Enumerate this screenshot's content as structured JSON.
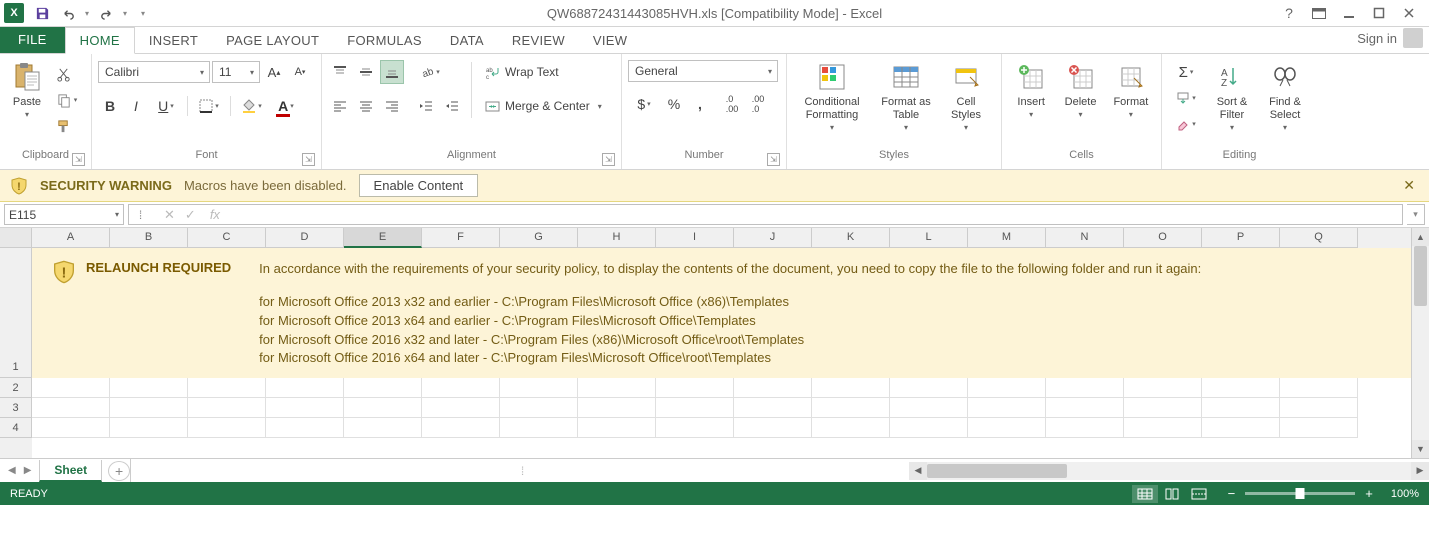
{
  "title": "QW68872431443085HVH.xls  [Compatibility Mode] - Excel",
  "signin": "Sign in",
  "tabs": {
    "file": "FILE",
    "home": "HOME",
    "insert": "INSERT",
    "page_layout": "PAGE LAYOUT",
    "formulas": "FORMULAS",
    "data": "DATA",
    "review": "REVIEW",
    "view": "VIEW"
  },
  "ribbon": {
    "clipboard": {
      "label": "Clipboard",
      "paste": "Paste"
    },
    "font": {
      "label": "Font",
      "name": "Calibri",
      "size": "11"
    },
    "alignment": {
      "label": "Alignment",
      "wrap": "Wrap Text",
      "merge": "Merge & Center"
    },
    "number": {
      "label": "Number",
      "format": "General"
    },
    "styles": {
      "label": "Styles",
      "cond": "Conditional Formatting",
      "table": "Format as Table",
      "cell": "Cell Styles"
    },
    "cells": {
      "label": "Cells",
      "insert": "Insert",
      "delete": "Delete",
      "format": "Format"
    },
    "editing": {
      "label": "Editing",
      "sort": "Sort & Filter",
      "find": "Find & Select"
    }
  },
  "security": {
    "title": "SECURITY WARNING",
    "msg": "Macros have been disabled.",
    "enable": "Enable Content"
  },
  "namebox": "E115",
  "fx_label": "fx",
  "columns": [
    "A",
    "B",
    "C",
    "D",
    "E",
    "F",
    "G",
    "H",
    "I",
    "J",
    "K",
    "L",
    "M",
    "N",
    "O",
    "P",
    "Q"
  ],
  "selected_col": "E",
  "rows": [
    "1",
    "2",
    "3",
    "4"
  ],
  "overlay": {
    "title": "RELAUNCH REQUIRED",
    "intro": "In accordance with the requirements of your security policy, to display the contents of the document, you need to copy the file to the following folder and run it again:",
    "lines": [
      "for Microsoft Office 2013 x32 and earlier - C:\\Program Files\\Microsoft Office (x86)\\Templates",
      "for Microsoft Office 2013 x64 and earlier - C:\\Program Files\\Microsoft Office\\Templates",
      "for Microsoft Office 2016 x32 and later - C:\\Program Files (x86)\\Microsoft Office\\root\\Templates",
      "for Microsoft Office 2016 x64 and later - C:\\Program Files\\Microsoft Office\\root\\Templates"
    ]
  },
  "sheet": "Sheet",
  "status": {
    "ready": "READY",
    "zoom": "100%"
  }
}
